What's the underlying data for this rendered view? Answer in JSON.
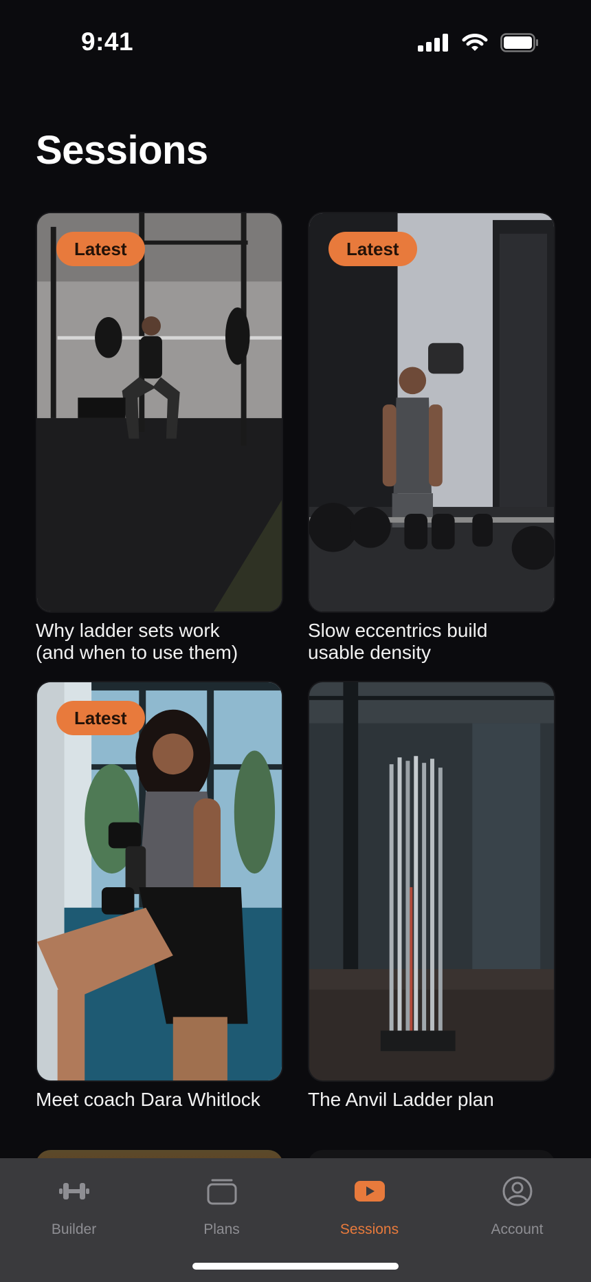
{
  "status_bar": {
    "time": "9:41"
  },
  "page": {
    "title": "Sessions"
  },
  "cards": [
    {
      "badge": "Latest",
      "caption_line1": "Why ladder sets work",
      "caption_line2": "(and when to use them)"
    },
    {
      "badge": "Latest",
      "caption_line1": "Slow eccentrics build",
      "caption_line2": "usable density"
    },
    {
      "badge": "Latest",
      "caption_line1": "Meet coach Dara Whitlock",
      "caption_line2": ""
    },
    {
      "badge": "",
      "caption_line1": "The Anvil Ladder plan",
      "caption_line2": ""
    }
  ],
  "tabs": [
    {
      "label": "Builder",
      "icon": "dumbbell-icon",
      "active": false
    },
    {
      "label": "Plans",
      "icon": "stack-icon",
      "active": false
    },
    {
      "label": "Sessions",
      "icon": "play-icon",
      "active": true
    },
    {
      "label": "Account",
      "icon": "person-icon",
      "active": false
    }
  ],
  "colors": {
    "accent": "#E87A3C",
    "background": "#0B0B0E",
    "tab_bar": "#3A3A3D",
    "inactive": "#8E8E93"
  }
}
